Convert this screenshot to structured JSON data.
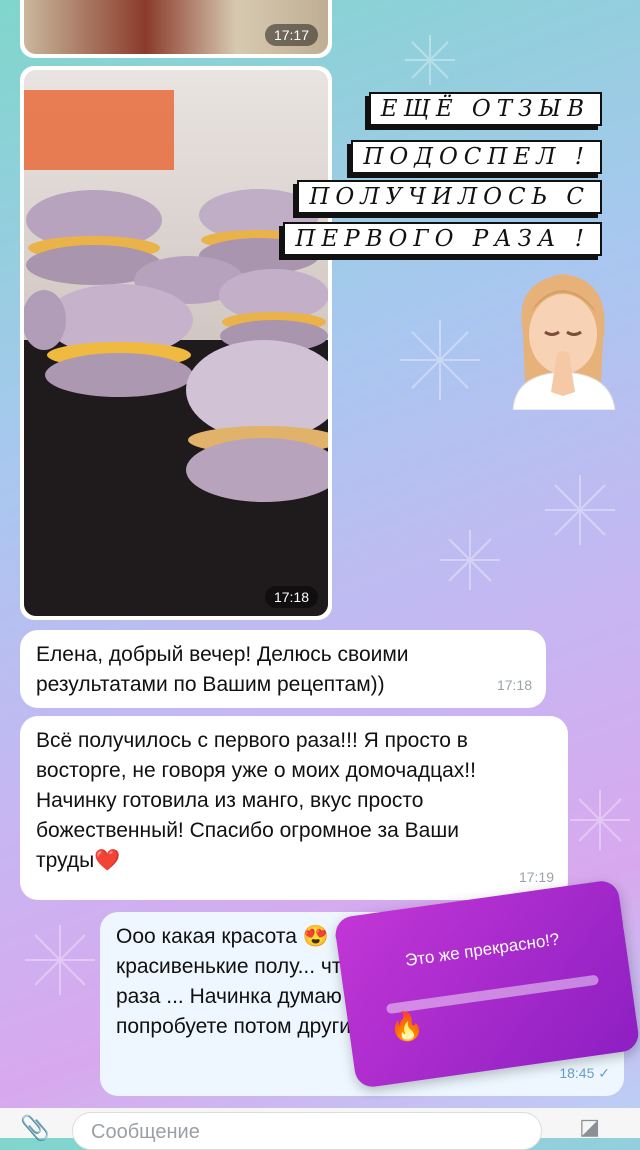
{
  "messages": [
    {
      "type": "photo",
      "time": "17:17"
    },
    {
      "type": "photo",
      "time": "17:18"
    },
    {
      "type": "text",
      "text": "Елена, добрый вечер! Делюсь своими результатами по Вашим рецептам))",
      "time": "17:18"
    },
    {
      "type": "text",
      "text": "Всё получилось с первого раза!!! Я просто в восторге, не говоря уже о моих домочадцах!! Начинку готовила из манго, вкус просто божественный! Спасибо огромное за Ваши труды❤️",
      "time": "17:19"
    },
    {
      "type": "text",
      "outgoing": true,
      "text": "Ооо какая красота 😍 Оч... красивенькие полу... что с первого раза ... Начинка думаю оче... попробуете потом другие ещё 😉",
      "time": "18:45"
    }
  ],
  "story_caption": [
    "ЕЩЁ ОТЗЫВ",
    "ПОДОСПЕЛ !",
    "ПОЛУЧИЛОСЬ С",
    "ПЕРВОГО РАЗА !"
  ],
  "poll": {
    "question": "Это же прекрасно!?",
    "emoji": "🔥"
  },
  "composer": {
    "placeholder": "Сообщение"
  },
  "colors": {
    "bubble": "#ffffff",
    "poll": "#b02ad0"
  }
}
